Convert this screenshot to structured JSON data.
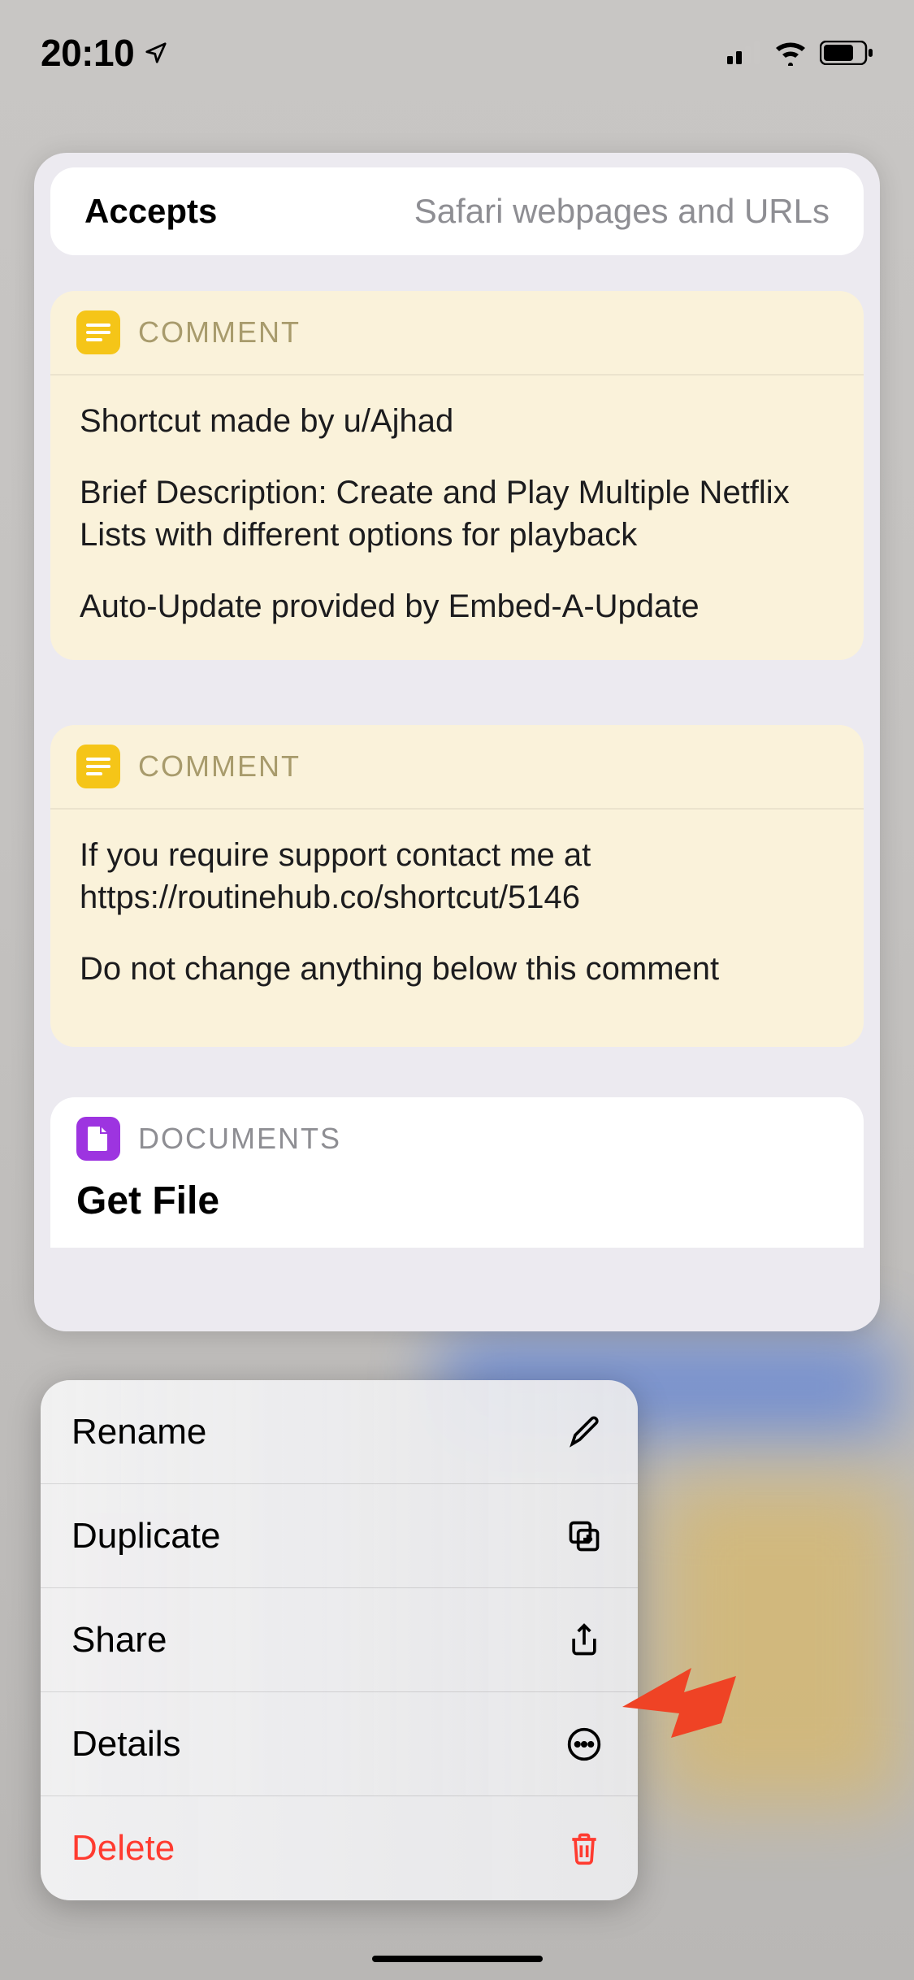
{
  "status": {
    "time": "20:10"
  },
  "sheet": {
    "accepts": {
      "label": "Accepts",
      "value": "Safari webpages and URLs"
    },
    "comments": [
      {
        "label": "COMMENT",
        "paragraphs": [
          "Shortcut made by u/Ajhad",
          "Brief Description: Create and Play Multiple Netflix Lists with different options for playback",
          "Auto-Update provided by Embed-A-Update"
        ]
      },
      {
        "label": "COMMENT",
        "paragraphs": [
          "If you require support contact me at https://routinehub.co/shortcut/5146",
          "Do not change anything below this comment"
        ]
      }
    ],
    "documents": {
      "label": "DOCUMENTS",
      "action": "Get File"
    }
  },
  "menu": {
    "rename": "Rename",
    "duplicate": "Duplicate",
    "share": "Share",
    "details": "Details",
    "delete": "Delete"
  }
}
